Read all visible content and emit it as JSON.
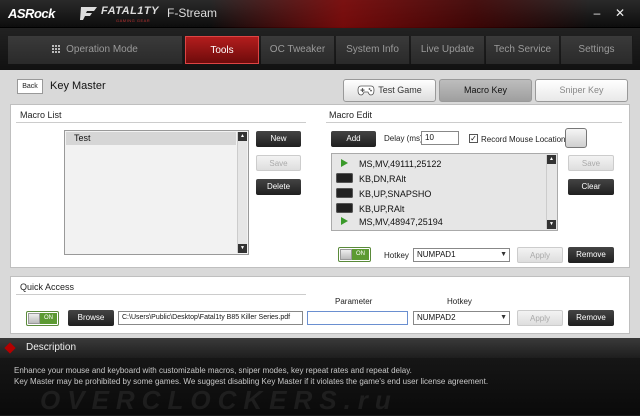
{
  "window": {
    "brand": "ASRock",
    "fatality": "FATAL1TY",
    "fatality_sub": "GAMING GEAR",
    "app_name": "F-Stream",
    "minimize": "–",
    "close": "✕"
  },
  "tabs": [
    {
      "label": "Operation Mode",
      "active": false
    },
    {
      "label": "Tools",
      "active": true
    },
    {
      "label": "OC Tweaker",
      "active": false
    },
    {
      "label": "System Info",
      "active": false
    },
    {
      "label": "Live Update",
      "active": false
    },
    {
      "label": "Tech Service",
      "active": false
    },
    {
      "label": "Settings",
      "active": false
    }
  ],
  "page": {
    "back_label": "Back",
    "title": "Key Master"
  },
  "modes": {
    "test_game": "Test Game",
    "macro_key": "Macro Key",
    "sniper_key": "Sniper Key"
  },
  "macro_list": {
    "title": "Macro List",
    "items": [
      "Test"
    ],
    "new_label": "New",
    "save_label": "Save",
    "delete_label": "Delete"
  },
  "macro_edit": {
    "title": "Macro Edit",
    "add_label": "Add",
    "delay_label": "Delay (ms)",
    "delay_value": "10",
    "record_mouse_label": "Record Mouse Location",
    "record_mouse_checked": true,
    "steps": [
      {
        "icon": "mouse",
        "text": "MS,MV,49111,25122"
      },
      {
        "icon": "keyboard",
        "text": "KB,DN,RAlt"
      },
      {
        "icon": "keyboard",
        "text": "KB,UP,SNAPSHO"
      },
      {
        "icon": "keyboard",
        "text": "KB,UP,RAlt"
      },
      {
        "icon": "mouse",
        "text": "MS,MV,48947,25194"
      }
    ],
    "save_label": "Save",
    "clear_label": "Clear",
    "toggle_label": "ON",
    "hotkey_label": "Hotkey",
    "hotkey_value": "NUMPAD1",
    "apply_label": "Apply",
    "remove_label": "Remove"
  },
  "quick_access": {
    "title": "Quick Access",
    "toggle_label": "ON",
    "browse_label": "Browse",
    "path_value": "C:\\Users\\Public\\Desktop\\Fatal1ty B85 Killer Series.pdf",
    "parameter_label": "Parameter",
    "parameter_value": "",
    "hotkey_label": "Hotkey",
    "hotkey_value": "NUMPAD2",
    "apply_label": "Apply",
    "remove_label": "Remove"
  },
  "description": {
    "title": "Description",
    "line1": "Enhance your mouse and keyboard with customizable macros, sniper modes, key repeat rates and repeat delay.",
    "line2": "Key Master may be prohibited by some games. We suggest disabling Key Master if it violates the game's end user license agreement.",
    "watermark": "OVERCLOCKERS.ru"
  },
  "colors": {
    "accent_red": "#b31d1d",
    "toggle_green": "#5c9a32"
  }
}
